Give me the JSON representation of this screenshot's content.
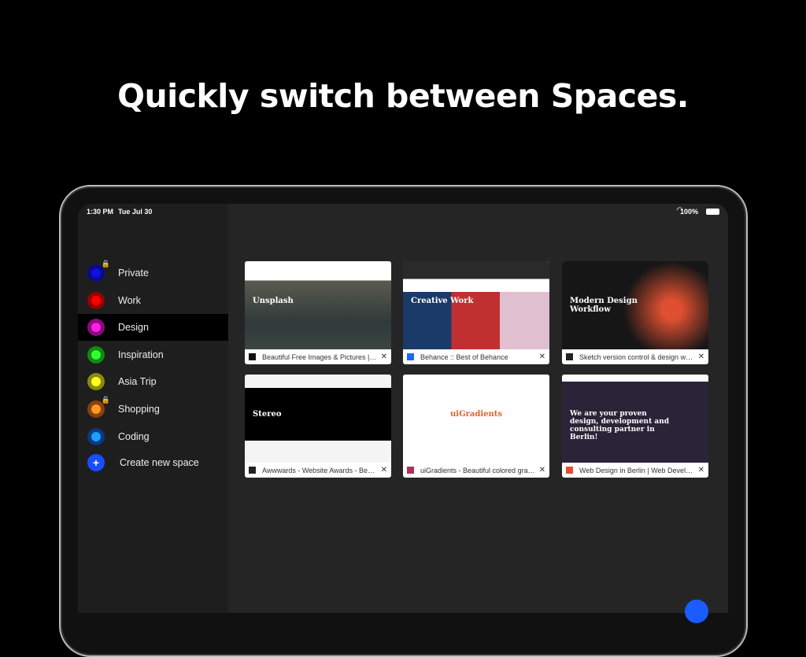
{
  "headline": "Quickly switch between Spaces.",
  "status": {
    "time": "1:30 PM",
    "date": "Tue Jul 30",
    "battery": "100%"
  },
  "spaces": [
    {
      "label": "Private",
      "color": "#1010e0",
      "ring": "#0a0a8a",
      "locked": true
    },
    {
      "label": "Work",
      "color": "#ff0000",
      "ring": "#990000",
      "locked": false
    },
    {
      "label": "Design",
      "color": "#ff20e0",
      "ring": "#8a0a80",
      "locked": false,
      "selected": true
    },
    {
      "label": "Inspiration",
      "color": "#30ff30",
      "ring": "#108a10",
      "locked": false
    },
    {
      "label": "Asia Trip",
      "color": "#ffff20",
      "ring": "#8a8a10",
      "locked": false
    },
    {
      "label": "Shopping",
      "color": "#ff9a20",
      "ring": "#8a4010",
      "locked": true
    },
    {
      "label": "Coding",
      "color": "#1aa0ff",
      "ring": "#0a3a80",
      "locked": false
    }
  ],
  "create_label": "Create new space",
  "tabs": [
    {
      "title": "Beautiful Free Images & Pictures | Unsplash",
      "favicon": "unsplash-icon",
      "fav_color": "#111",
      "thumb_text": "Unsplash"
    },
    {
      "title": "Behance :: Best of Behance",
      "favicon": "behance-icon",
      "fav_color": "#1769ff",
      "thumb_text": "Creative Work"
    },
    {
      "title": "Sketch version control & design workflow",
      "favicon": "abstract-icon",
      "fav_color": "#222",
      "thumb_text": "Modern Design Workflow"
    },
    {
      "title": "Awwwards - Website Awards - Best Web Design",
      "favicon": "awwwards-icon",
      "fav_color": "#222",
      "thumb_text": "Stereo"
    },
    {
      "title": "uiGradients - Beautiful colored gradients",
      "favicon": "uigradients-icon",
      "fav_color": "#b03060",
      "thumb_text": "uiGradients"
    },
    {
      "title": "Web Design in Berlin | Web Development",
      "favicon": "agency-icon",
      "fav_color": "#e05030",
      "thumb_text": "We are your proven design, development and consulting partner in Berlin!"
    }
  ]
}
